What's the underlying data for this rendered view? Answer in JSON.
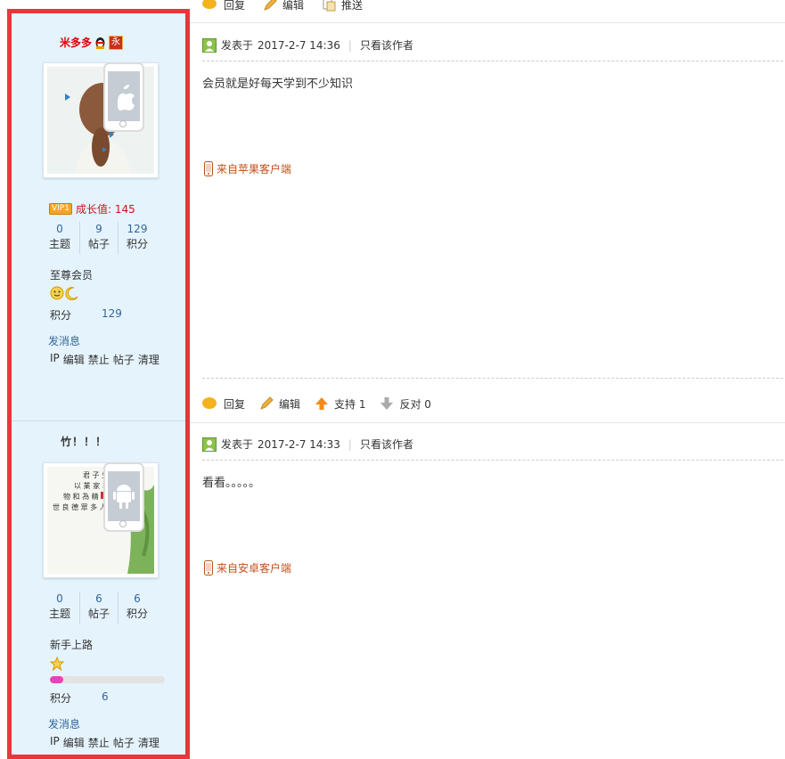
{
  "top_toolbar": {
    "reply": "回复",
    "edit": "编辑",
    "push": "推送"
  },
  "posts": [
    {
      "author": {
        "name": "米多多",
        "badge_text": "永",
        "vip_label": "VIP1",
        "growth_label": "成长值: 145",
        "stats": [
          {
            "value": "0",
            "label": "主题"
          },
          {
            "value": "9",
            "label": "帖子"
          },
          {
            "value": "129",
            "label": "积分"
          }
        ],
        "group": "至尊会员",
        "points_label": "积分",
        "points_value": "129",
        "send_message": "发消息",
        "admin_links": [
          "IP",
          "编辑",
          "禁止",
          "帖子",
          "清理"
        ],
        "device_icon": "apple-phone-icon"
      },
      "meta": {
        "posted_prefix": "发表于",
        "datetime": "2017-2-7 14:36",
        "only_author": "只看该作者"
      },
      "content": "会员就是好每天学到不少知识",
      "source": "来自苹果客户端",
      "actions": {
        "reply": "回复",
        "edit": "编辑",
        "support": "支持 1",
        "oppose": "反对 0"
      }
    },
    {
      "author": {
        "name": "竹！！！",
        "stats": [
          {
            "value": "0",
            "label": "主题"
          },
          {
            "value": "6",
            "label": "帖子"
          },
          {
            "value": "6",
            "label": "积分"
          }
        ],
        "group": "新手上路",
        "progress": 0.12,
        "points_label": "积分",
        "points_value": "6",
        "send_message": "发消息",
        "admin_links": [
          "IP",
          "编辑",
          "禁止",
          "帖子",
          "清理"
        ],
        "device_icon": "android-phone-icon"
      },
      "meta": {
        "posted_prefix": "发表于",
        "datetime": "2017-2-7 14:33",
        "only_author": "只看该作者"
      },
      "content": "看看。。。。。",
      "source": "来自安卓客户端"
    }
  ],
  "colors": {
    "highlight_frame": "#e8363d",
    "sidebar_bg": "#e5f3fd",
    "link_blue": "#336699",
    "username_red": "#e00000",
    "source_orange": "#c0511d"
  }
}
